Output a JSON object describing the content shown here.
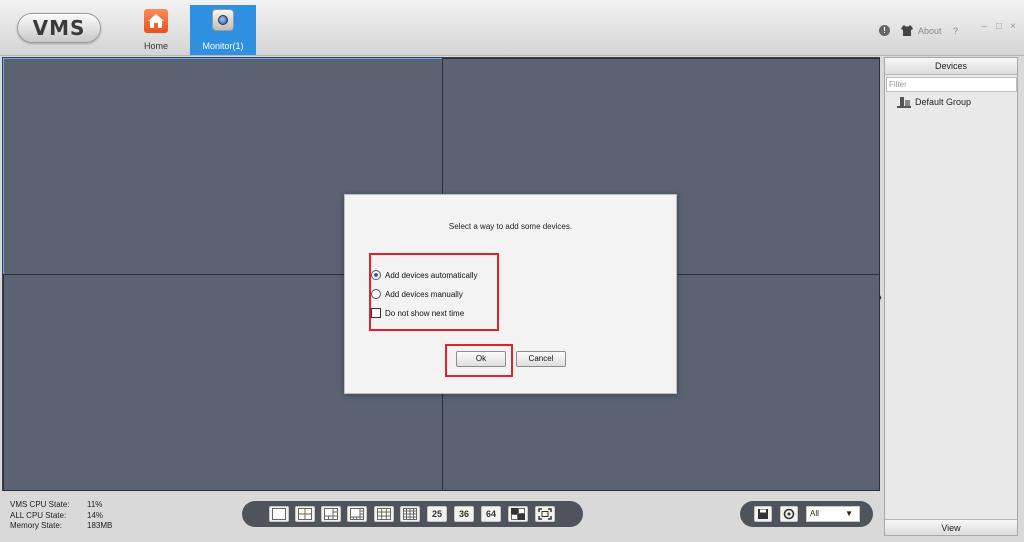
{
  "app": {
    "logo": "VMS"
  },
  "nav": {
    "home_label": "Home",
    "monitor_label": "Monitor(1)"
  },
  "topbar": {
    "about_label": "About",
    "help_label": "?"
  },
  "devices": {
    "title": "Devices",
    "filter_placeholder": "Filter",
    "groups": [
      "Default Group"
    ],
    "view_label": "View"
  },
  "status": {
    "vms_cpu_label": "VMS CPU State:",
    "vms_cpu_value": "11%",
    "all_cpu_label": "ALL CPU State:",
    "all_cpu_value": "14%",
    "memory_label": "Memory State:",
    "memory_value": "183MB"
  },
  "layouts": {
    "n25": "25",
    "n36": "36",
    "n64": "64"
  },
  "stream_select": {
    "value": "All"
  },
  "dialog": {
    "prompt": "Select a way to add some devices.",
    "auto_label": "Add devices automatically",
    "manual_label": "Add devices manually",
    "dont_show_label": "Do not show next time",
    "ok_label": "Ok",
    "cancel_label": "Cancel",
    "selected_option": "auto",
    "dont_show_checked": false
  },
  "colors": {
    "accent": "#2f8fe0",
    "video_bg": "#5b6373",
    "highlight": "#e3202f",
    "radio_dot": "#2a62d0"
  }
}
